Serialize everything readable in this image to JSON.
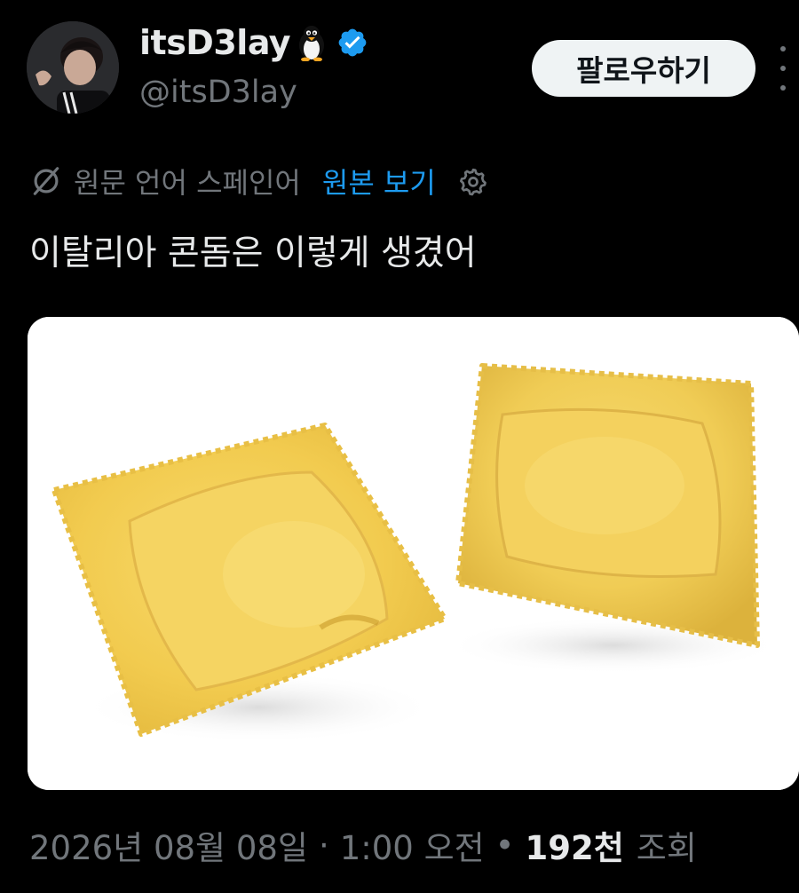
{
  "author": {
    "display_name": "itsD3lay",
    "emoji": "🐧",
    "handle": "@itsD3lay",
    "verified_icon": "verified-badge-icon",
    "avatar_icon": "avatar"
  },
  "follow_button": {
    "label": "팔로우하기"
  },
  "more_icon": "more-vertical-icon",
  "translation": {
    "icon": "translate-off-icon",
    "label": "원문 언어 스페인어",
    "link": "원본 보기",
    "settings_icon": "gear-icon"
  },
  "tweet": {
    "text": "이탈리아 콘돔은 이렇게 생겼어"
  },
  "meta": {
    "date": "2026년 08월 08일",
    "separator1": "·",
    "time": "1:00 오전",
    "separator2": "•",
    "views_count": "192천",
    "views_label": "조회"
  },
  "colors": {
    "background": "#000000",
    "primary_text": "#e7e9ea",
    "secondary_text": "#71767b",
    "link": "#1d9bf0",
    "verified": "#1d9bf0",
    "button_bg": "#eff3f4"
  }
}
